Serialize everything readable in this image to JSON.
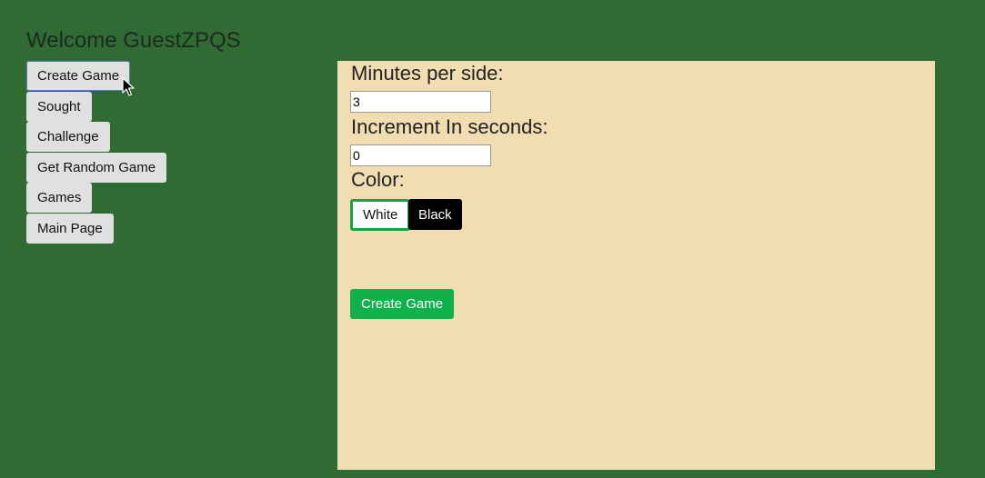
{
  "header": {
    "welcome_text": "Welcome GuestZPQS"
  },
  "nav": {
    "items": [
      {
        "label": "Create Game"
      },
      {
        "label": "Sought"
      },
      {
        "label": "Challenge"
      },
      {
        "label": "Get Random Game"
      },
      {
        "label": "Games"
      },
      {
        "label": "Main Page"
      }
    ]
  },
  "form": {
    "minutes_label": "Minutes per side:",
    "minutes_value": "3",
    "increment_label": "Increment In seconds:",
    "increment_value": "0",
    "color_label": "Color:",
    "color_white_label": "White",
    "color_black_label": "Black",
    "selected_color": "White",
    "submit_label": "Create Game"
  },
  "colors": {
    "background": "#306b34",
    "panel": "#f1ddb2",
    "accent_green": "#0fb14a"
  }
}
